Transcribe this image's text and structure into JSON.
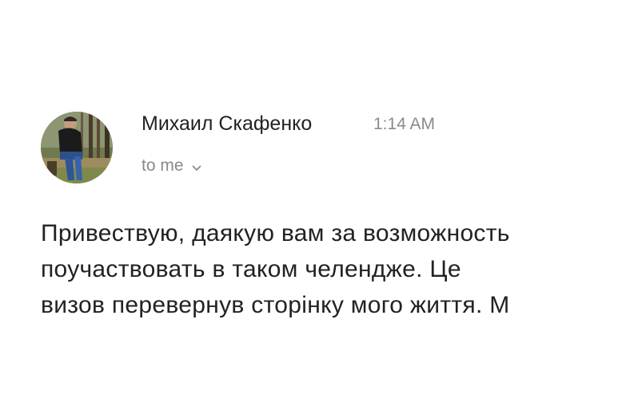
{
  "message": {
    "sender_name": "Михаил Скафенко",
    "time": "1:14 AM",
    "recipient": "to me",
    "recipient_toggle_icon": "chevron-down-icon",
    "avatar_icon": "sender-avatar-photo",
    "body_lines": [
      "Привествую, даякую вам за возможность",
      "поучаствовать в таком челендже. Це",
      "визов перевернув сторінку мого життя. М"
    ]
  },
  "colors": {
    "text_primary": "#222222",
    "text_secondary": "#8a8a8f",
    "background": "#ffffff"
  }
}
